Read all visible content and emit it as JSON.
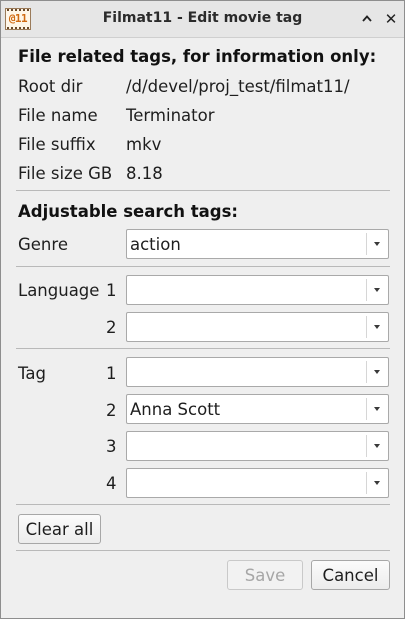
{
  "window": {
    "title": "Filmat11 - Edit movie tag",
    "app_icon_text": "@11"
  },
  "file_section": {
    "heading": "File related tags, for information only:",
    "rows": [
      {
        "label": "Root dir",
        "value": "/d/devel/proj_test/filmat11/"
      },
      {
        "label": "File name",
        "value": "Terminator"
      },
      {
        "label": "File suffix",
        "value": "mkv"
      },
      {
        "label": "File size GB",
        "value": "8.18"
      }
    ]
  },
  "search_section": {
    "heading": "Adjustable search tags:",
    "genre": {
      "label": "Genre",
      "value": "action"
    },
    "language": {
      "label": "Language",
      "fields": [
        {
          "index": "1",
          "value": ""
        },
        {
          "index": "2",
          "value": ""
        }
      ]
    },
    "tag": {
      "label": "Tag",
      "fields": [
        {
          "index": "1",
          "value": ""
        },
        {
          "index": "2",
          "value": "Anna Scott"
        },
        {
          "index": "3",
          "value": ""
        },
        {
          "index": "4",
          "value": ""
        }
      ]
    }
  },
  "buttons": {
    "clear_all": "Clear all",
    "save": "Save",
    "cancel": "Cancel"
  }
}
